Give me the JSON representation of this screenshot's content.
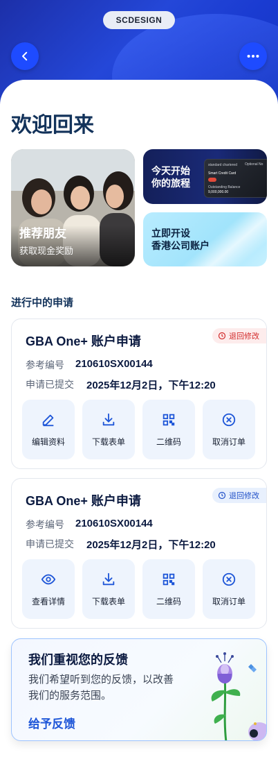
{
  "header": {
    "brand": "SCDESIGN",
    "back_icon": "chevron-left-icon",
    "more_icon": "more-horizontal-icon"
  },
  "welcome_title": "欢迎回来",
  "promos": {
    "referral": {
      "title": "推荐朋友",
      "subtitle": "获取现金奖励"
    },
    "journey": {
      "line1": "今天开始",
      "line2": "你的旅程"
    },
    "open_account": {
      "line1": "立即开设",
      "line2": "香港公司账户"
    }
  },
  "card_art": {
    "bank": "standard chartered",
    "name": "Smart Credit Card",
    "balance_label": "Outstanding Balance",
    "balance": "9,000,000.00",
    "optional": "Optional No"
  },
  "applications_title": "进行中的申请",
  "applications": [
    {
      "title": "GBA One+ 账户申请",
      "status": "退回修改",
      "status_color": "#d22b2b",
      "ref_label": "参考编号",
      "ref_value": "210610SX00144",
      "submitted_label": "申请已提交",
      "submitted_value": "2025年12月2日，下午12:20",
      "actions": [
        {
          "label": "编辑资料",
          "icon": "edit-icon"
        },
        {
          "label": "下载表单",
          "icon": "download-icon"
        },
        {
          "label": "二维码",
          "icon": "qr-code-icon"
        },
        {
          "label": "取消订单",
          "icon": "cancel-circle-icon"
        }
      ]
    },
    {
      "title": "GBA One+ 账户申请",
      "status": "退回修改",
      "status_color": "#2050c8",
      "ref_label": "参考编号",
      "ref_value": "210610SX00144",
      "submitted_label": "申请已提交",
      "submitted_value": "2025年12月2日，下午12:20",
      "actions": [
        {
          "label": "查看详情",
          "icon": "eye-icon"
        },
        {
          "label": "下载表单",
          "icon": "download-icon"
        },
        {
          "label": "二维码",
          "icon": "qr-code-icon"
        },
        {
          "label": "取消订单",
          "icon": "cancel-circle-icon"
        }
      ]
    }
  ],
  "feedback": {
    "title": "我们重视您的反馈",
    "description": "我们希望听到您的反馈，以改善我们的服务范围。",
    "link": "给予反馈"
  },
  "colors": {
    "primary": "#1e4bff",
    "navy": "#12325a",
    "action_bg": "#eef4fd"
  }
}
